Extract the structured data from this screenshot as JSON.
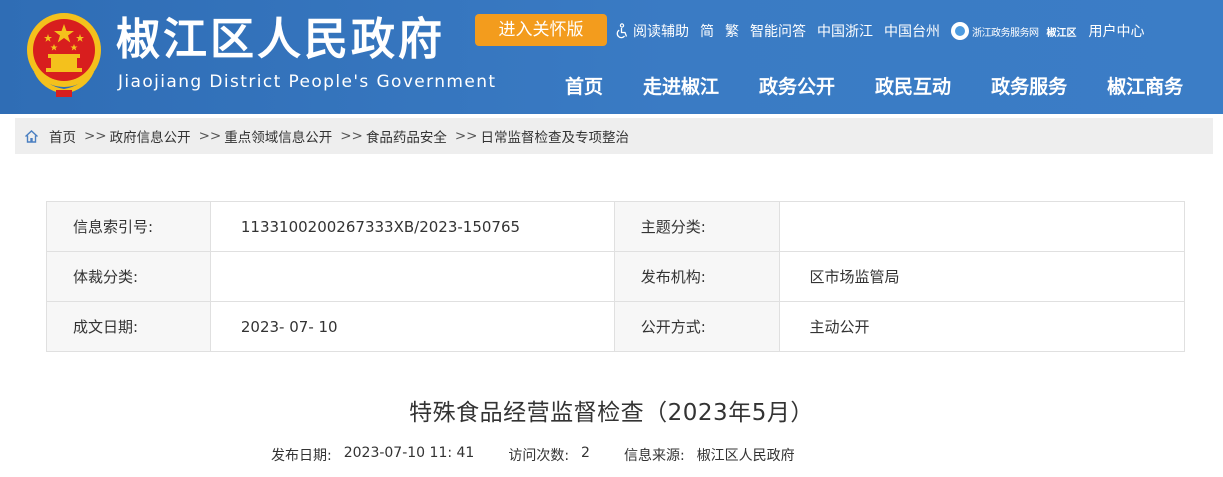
{
  "header": {
    "title": "椒江区人民政府",
    "subtitle": "Jiaojiang District People's Government",
    "care_button": "进入关怀版",
    "top_links": {
      "reading_aid": "阅读辅助",
      "simplified": "简",
      "traditional": "繁",
      "smart_qa": "智能问答",
      "zhejiang": "中国浙江",
      "taizhou": "中国台州",
      "zjfw": "浙江政务服务网",
      "zjfw_district": "椒江区",
      "user_center": "用户中心"
    },
    "nav": [
      "首页",
      "走进椒江",
      "政务公开",
      "政民互动",
      "政务服务",
      "椒江商务"
    ],
    "colors": {
      "header_bg": "#3a7bc4",
      "care_btn": "#f39c1d"
    }
  },
  "breadcrumb": {
    "icon": "home-icon",
    "items": [
      "首页",
      "政府信息公开",
      "重点领域信息公开",
      "食品药品安全",
      "日常监督检查及专项整治"
    ],
    "separator": ">>"
  },
  "info": {
    "index_label": "信息索引号:",
    "index_value": "113310020026733​3XB/2023-150765",
    "topic_label": "主题分类:",
    "topic_value": "",
    "genre_label": "体裁分类:",
    "genre_value": "",
    "publisher_label": "发布机构:",
    "publisher_value": "区市场监管局",
    "date_label": "成文日期:",
    "date_value": "2023- 07- 10",
    "open_label": "公开方式:",
    "open_value": "主动公开"
  },
  "article": {
    "title": "特殊食品经营监督检查（2023年5月）",
    "publish_date_label": "发布日期:",
    "publish_date": "2023-07-10 11: 41",
    "visits_label": "访问次数:",
    "visits": "2",
    "source_label": "信息来源:",
    "source": "椒江区人民政府"
  }
}
